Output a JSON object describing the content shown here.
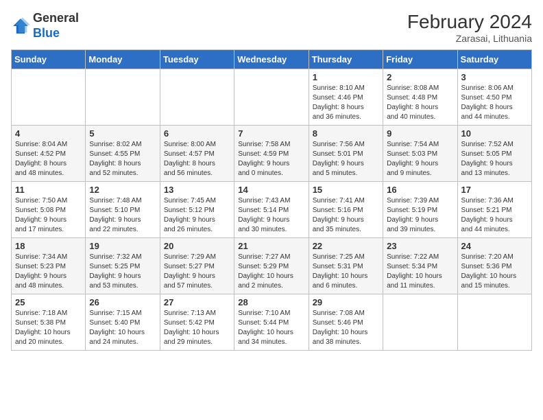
{
  "header": {
    "logo_line1": "General",
    "logo_line2": "Blue",
    "month_year": "February 2024",
    "location": "Zarasai, Lithuania"
  },
  "days_of_week": [
    "Sunday",
    "Monday",
    "Tuesday",
    "Wednesday",
    "Thursday",
    "Friday",
    "Saturday"
  ],
  "weeks": [
    [
      {
        "day": "",
        "info": ""
      },
      {
        "day": "",
        "info": ""
      },
      {
        "day": "",
        "info": ""
      },
      {
        "day": "",
        "info": ""
      },
      {
        "day": "1",
        "info": "Sunrise: 8:10 AM\nSunset: 4:46 PM\nDaylight: 8 hours\nand 36 minutes."
      },
      {
        "day": "2",
        "info": "Sunrise: 8:08 AM\nSunset: 4:48 PM\nDaylight: 8 hours\nand 40 minutes."
      },
      {
        "day": "3",
        "info": "Sunrise: 8:06 AM\nSunset: 4:50 PM\nDaylight: 8 hours\nand 44 minutes."
      }
    ],
    [
      {
        "day": "4",
        "info": "Sunrise: 8:04 AM\nSunset: 4:52 PM\nDaylight: 8 hours\nand 48 minutes."
      },
      {
        "day": "5",
        "info": "Sunrise: 8:02 AM\nSunset: 4:55 PM\nDaylight: 8 hours\nand 52 minutes."
      },
      {
        "day": "6",
        "info": "Sunrise: 8:00 AM\nSunset: 4:57 PM\nDaylight: 8 hours\nand 56 minutes."
      },
      {
        "day": "7",
        "info": "Sunrise: 7:58 AM\nSunset: 4:59 PM\nDaylight: 9 hours\nand 0 minutes."
      },
      {
        "day": "8",
        "info": "Sunrise: 7:56 AM\nSunset: 5:01 PM\nDaylight: 9 hours\nand 5 minutes."
      },
      {
        "day": "9",
        "info": "Sunrise: 7:54 AM\nSunset: 5:03 PM\nDaylight: 9 hours\nand 9 minutes."
      },
      {
        "day": "10",
        "info": "Sunrise: 7:52 AM\nSunset: 5:05 PM\nDaylight: 9 hours\nand 13 minutes."
      }
    ],
    [
      {
        "day": "11",
        "info": "Sunrise: 7:50 AM\nSunset: 5:08 PM\nDaylight: 9 hours\nand 17 minutes."
      },
      {
        "day": "12",
        "info": "Sunrise: 7:48 AM\nSunset: 5:10 PM\nDaylight: 9 hours\nand 22 minutes."
      },
      {
        "day": "13",
        "info": "Sunrise: 7:45 AM\nSunset: 5:12 PM\nDaylight: 9 hours\nand 26 minutes."
      },
      {
        "day": "14",
        "info": "Sunrise: 7:43 AM\nSunset: 5:14 PM\nDaylight: 9 hours\nand 30 minutes."
      },
      {
        "day": "15",
        "info": "Sunrise: 7:41 AM\nSunset: 5:16 PM\nDaylight: 9 hours\nand 35 minutes."
      },
      {
        "day": "16",
        "info": "Sunrise: 7:39 AM\nSunset: 5:19 PM\nDaylight: 9 hours\nand 39 minutes."
      },
      {
        "day": "17",
        "info": "Sunrise: 7:36 AM\nSunset: 5:21 PM\nDaylight: 9 hours\nand 44 minutes."
      }
    ],
    [
      {
        "day": "18",
        "info": "Sunrise: 7:34 AM\nSunset: 5:23 PM\nDaylight: 9 hours\nand 48 minutes."
      },
      {
        "day": "19",
        "info": "Sunrise: 7:32 AM\nSunset: 5:25 PM\nDaylight: 9 hours\nand 53 minutes."
      },
      {
        "day": "20",
        "info": "Sunrise: 7:29 AM\nSunset: 5:27 PM\nDaylight: 9 hours\nand 57 minutes."
      },
      {
        "day": "21",
        "info": "Sunrise: 7:27 AM\nSunset: 5:29 PM\nDaylight: 10 hours\nand 2 minutes."
      },
      {
        "day": "22",
        "info": "Sunrise: 7:25 AM\nSunset: 5:31 PM\nDaylight: 10 hours\nand 6 minutes."
      },
      {
        "day": "23",
        "info": "Sunrise: 7:22 AM\nSunset: 5:34 PM\nDaylight: 10 hours\nand 11 minutes."
      },
      {
        "day": "24",
        "info": "Sunrise: 7:20 AM\nSunset: 5:36 PM\nDaylight: 10 hours\nand 15 minutes."
      }
    ],
    [
      {
        "day": "25",
        "info": "Sunrise: 7:18 AM\nSunset: 5:38 PM\nDaylight: 10 hours\nand 20 minutes."
      },
      {
        "day": "26",
        "info": "Sunrise: 7:15 AM\nSunset: 5:40 PM\nDaylight: 10 hours\nand 24 minutes."
      },
      {
        "day": "27",
        "info": "Sunrise: 7:13 AM\nSunset: 5:42 PM\nDaylight: 10 hours\nand 29 minutes."
      },
      {
        "day": "28",
        "info": "Sunrise: 7:10 AM\nSunset: 5:44 PM\nDaylight: 10 hours\nand 34 minutes."
      },
      {
        "day": "29",
        "info": "Sunrise: 7:08 AM\nSunset: 5:46 PM\nDaylight: 10 hours\nand 38 minutes."
      },
      {
        "day": "",
        "info": ""
      },
      {
        "day": "",
        "info": ""
      }
    ]
  ]
}
